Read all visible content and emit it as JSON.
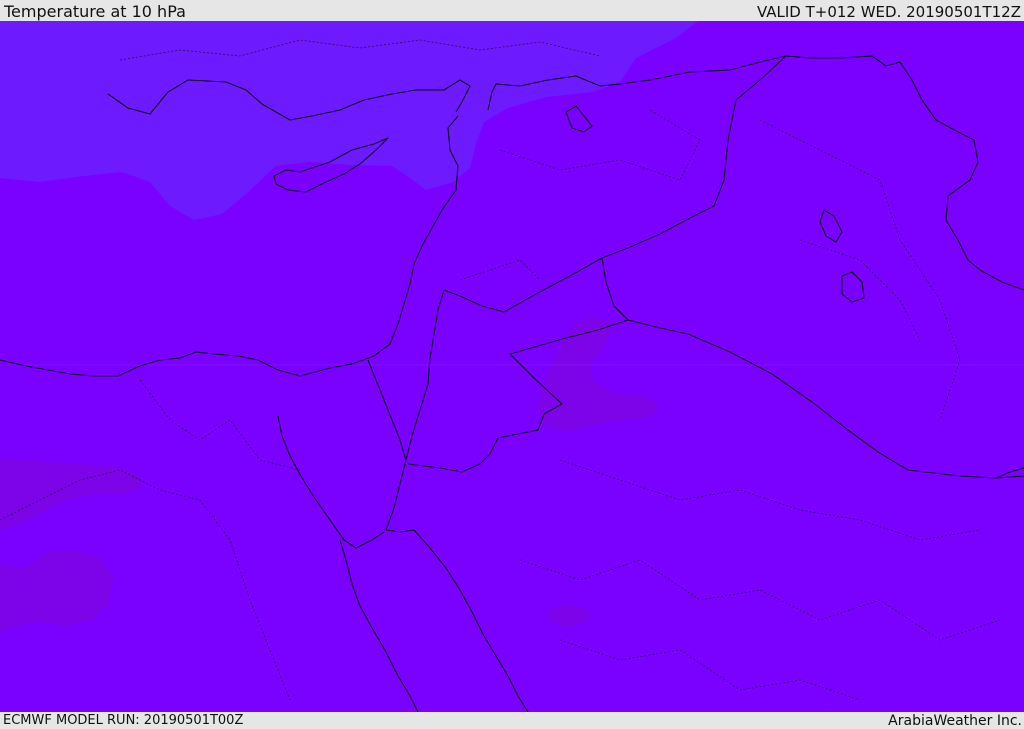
{
  "header": {
    "title": "Temperature at 10 hPa",
    "valid": "VALID T+012 WED. 20190501T12Z"
  },
  "footer": {
    "model_run": "ECMWF MODEL RUN: 20190501T00Z",
    "credit": "ArabiaWeather Inc."
  },
  "map_colors": {
    "base_field": "#7a00ff",
    "cold_region": "#6e1aff",
    "warm_patches": "#7d04e9",
    "border_line": "#0d0620",
    "sub_border_line": "#2a0a55"
  }
}
